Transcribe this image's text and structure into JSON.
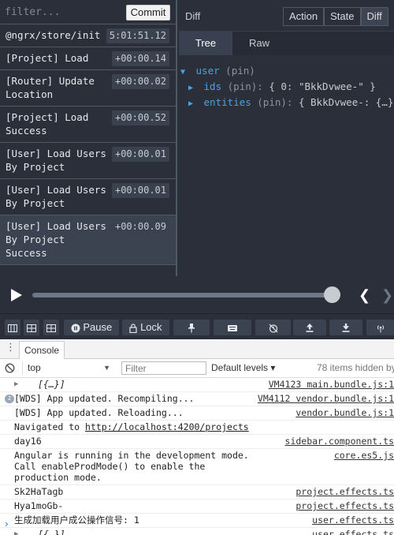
{
  "actions_pane": {
    "filter_placeholder": "filter...",
    "commit_label": "Commit",
    "actions": [
      {
        "name": "@ngrx/store/init",
        "time": "5:01:51.12"
      },
      {
        "name": "[Project] Load",
        "time": "+00:00.14"
      },
      {
        "name": "[Router] Update Location",
        "time": "+00:00.02"
      },
      {
        "name": "[Project] Load Success",
        "time": "+00:00.52"
      },
      {
        "name": "[User] Load Users By Project",
        "time": "+00:00.01"
      },
      {
        "name": "[User] Load Users By Project",
        "time": "+00:00.01"
      },
      {
        "name": "[User] Load Users By Project Success",
        "time": "+00:00.09"
      }
    ]
  },
  "state_pane": {
    "diff_label": "Diff",
    "mode_tabs": [
      "Action",
      "State",
      "Diff"
    ],
    "active_mode": "Diff",
    "view_tabs": [
      "Tree",
      "Raw"
    ],
    "active_view": "Tree",
    "tree": {
      "root_key": "user",
      "root_meta": "(pin)",
      "children": [
        {
          "key": "ids",
          "meta": "(pin):",
          "value": "{ 0: \"BkkDvwee-\" }"
        },
        {
          "key": "entities",
          "meta": "(pin):",
          "value": "{ BkkDvwee-: {…} }"
        }
      ]
    }
  },
  "slider": {
    "position": 1.0,
    "play_icon": "play-icon",
    "prev_icon": "chevron-left-icon",
    "next_icon": "chevron-right-icon"
  },
  "toolbar": {
    "pause_label": "Pause",
    "lock_label": "Lock"
  },
  "console": {
    "menu_icon": "⋮",
    "tab_label": "Console",
    "context_value": "top",
    "filter_placeholder": "Filter",
    "levels_label": "Default levels ▾",
    "hidden_count": "78 items hidden by f",
    "rows": [
      {
        "text": "[{…}]",
        "source": "VM4123 main.bundle.js:1"
      },
      {
        "text": "[WDS] App updated. Recompiling...",
        "source": "VM4112 vendor.bundle.js:1"
      },
      {
        "text": "[WDS] App updated. Reloading...",
        "source": "vendor.bundle.js:1"
      },
      {
        "text_prefix": "Navigated to ",
        "link": "http://localhost:4200/projects",
        "source": ""
      },
      {
        "text": "day16",
        "source": "sidebar.component.ts"
      },
      {
        "text": "Angular is running in the development mode. Call enableProdMode() to enable the production mode.",
        "source": "core.es5.js"
      },
      {
        "text": "Sk2HaTagb",
        "source": "project.effects.ts"
      },
      {
        "text": "Hya1moGb-",
        "source": "project.effects.ts"
      },
      {
        "text": "生成加载用户成公操作信号: 1",
        "source": "user.effects.ts"
      },
      {
        "text": "[{…}]",
        "source": "user.effects.ts"
      }
    ],
    "prompt": "›"
  }
}
